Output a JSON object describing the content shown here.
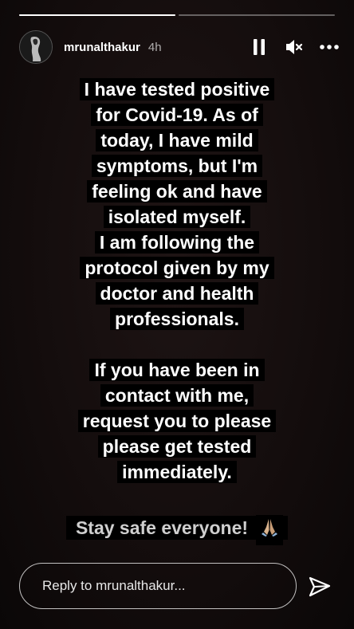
{
  "story": {
    "username": "mrunalthakur",
    "time_ago": "4h",
    "progress": [
      1,
      0
    ],
    "text_lines": [
      "I have tested positive",
      "for Covid-19. As of",
      "today, I have mild",
      "symptoms, but I'm",
      "feeling ok and have",
      "isolated myself.",
      "I am following the",
      "protocol given by my",
      "doctor and health",
      "professionals.",
      "",
      "If you have been in",
      "contact with me,",
      "request you to please",
      "please get tested",
      "immediately."
    ],
    "closing": "Stay safe everyone!"
  },
  "controls": {
    "pause_icon": "pause-icon",
    "mute_icon": "speaker-muted-icon",
    "more_icon": "more-options-icon"
  },
  "reply": {
    "placeholder": "Reply to mrunalthakur..."
  }
}
